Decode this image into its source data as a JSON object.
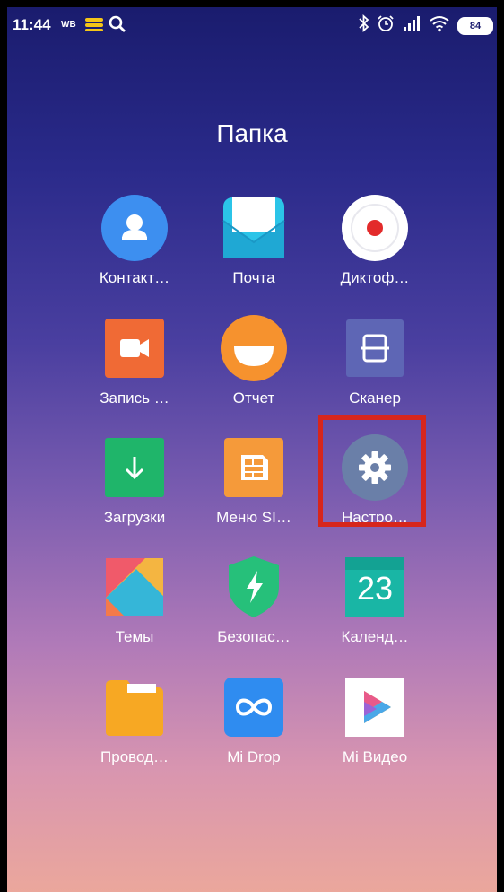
{
  "status_bar": {
    "time": "11:44",
    "carrier_tag": "WB",
    "battery": "84"
  },
  "folder": {
    "title": "Папка"
  },
  "apps": [
    {
      "label": "Контакт…",
      "icon": "contacts-icon"
    },
    {
      "label": "Почта",
      "icon": "mail-icon"
    },
    {
      "label": "Диктоф…",
      "icon": "recorder-icon"
    },
    {
      "label": "Запись …",
      "icon": "screen-record-icon"
    },
    {
      "label": "Отчет",
      "icon": "feedback-icon"
    },
    {
      "label": "Сканер",
      "icon": "scanner-icon"
    },
    {
      "label": "Загрузки",
      "icon": "downloads-icon"
    },
    {
      "label": "Меню SI…",
      "icon": "sim-menu-icon"
    },
    {
      "label": "Настро…",
      "icon": "settings-icon"
    },
    {
      "label": "Темы",
      "icon": "themes-icon"
    },
    {
      "label": "Безопас…",
      "icon": "security-icon"
    },
    {
      "label": "Календ…",
      "icon": "calendar-icon"
    },
    {
      "label": "Провод…",
      "icon": "file-manager-icon"
    },
    {
      "label": "Mi Drop",
      "icon": "mi-drop-icon"
    },
    {
      "label": "Mi Видео",
      "icon": "mi-video-icon"
    }
  ],
  "calendar_day": "23",
  "colors": {
    "highlight": "#d7261c",
    "contacts": "#3d8ff0",
    "mail": "#2bc4e8",
    "screen_record": "#f06a35",
    "feedback": "#f6922e",
    "scanner": "#5e66b5",
    "downloads": "#1fb56a",
    "sim_menu": "#f59a3a",
    "settings": "#6a7fa8",
    "security": "#26c07a",
    "calendar": "#19b6a5",
    "file_manager": "#f7a823",
    "mi_drop": "#2f8cf0"
  }
}
